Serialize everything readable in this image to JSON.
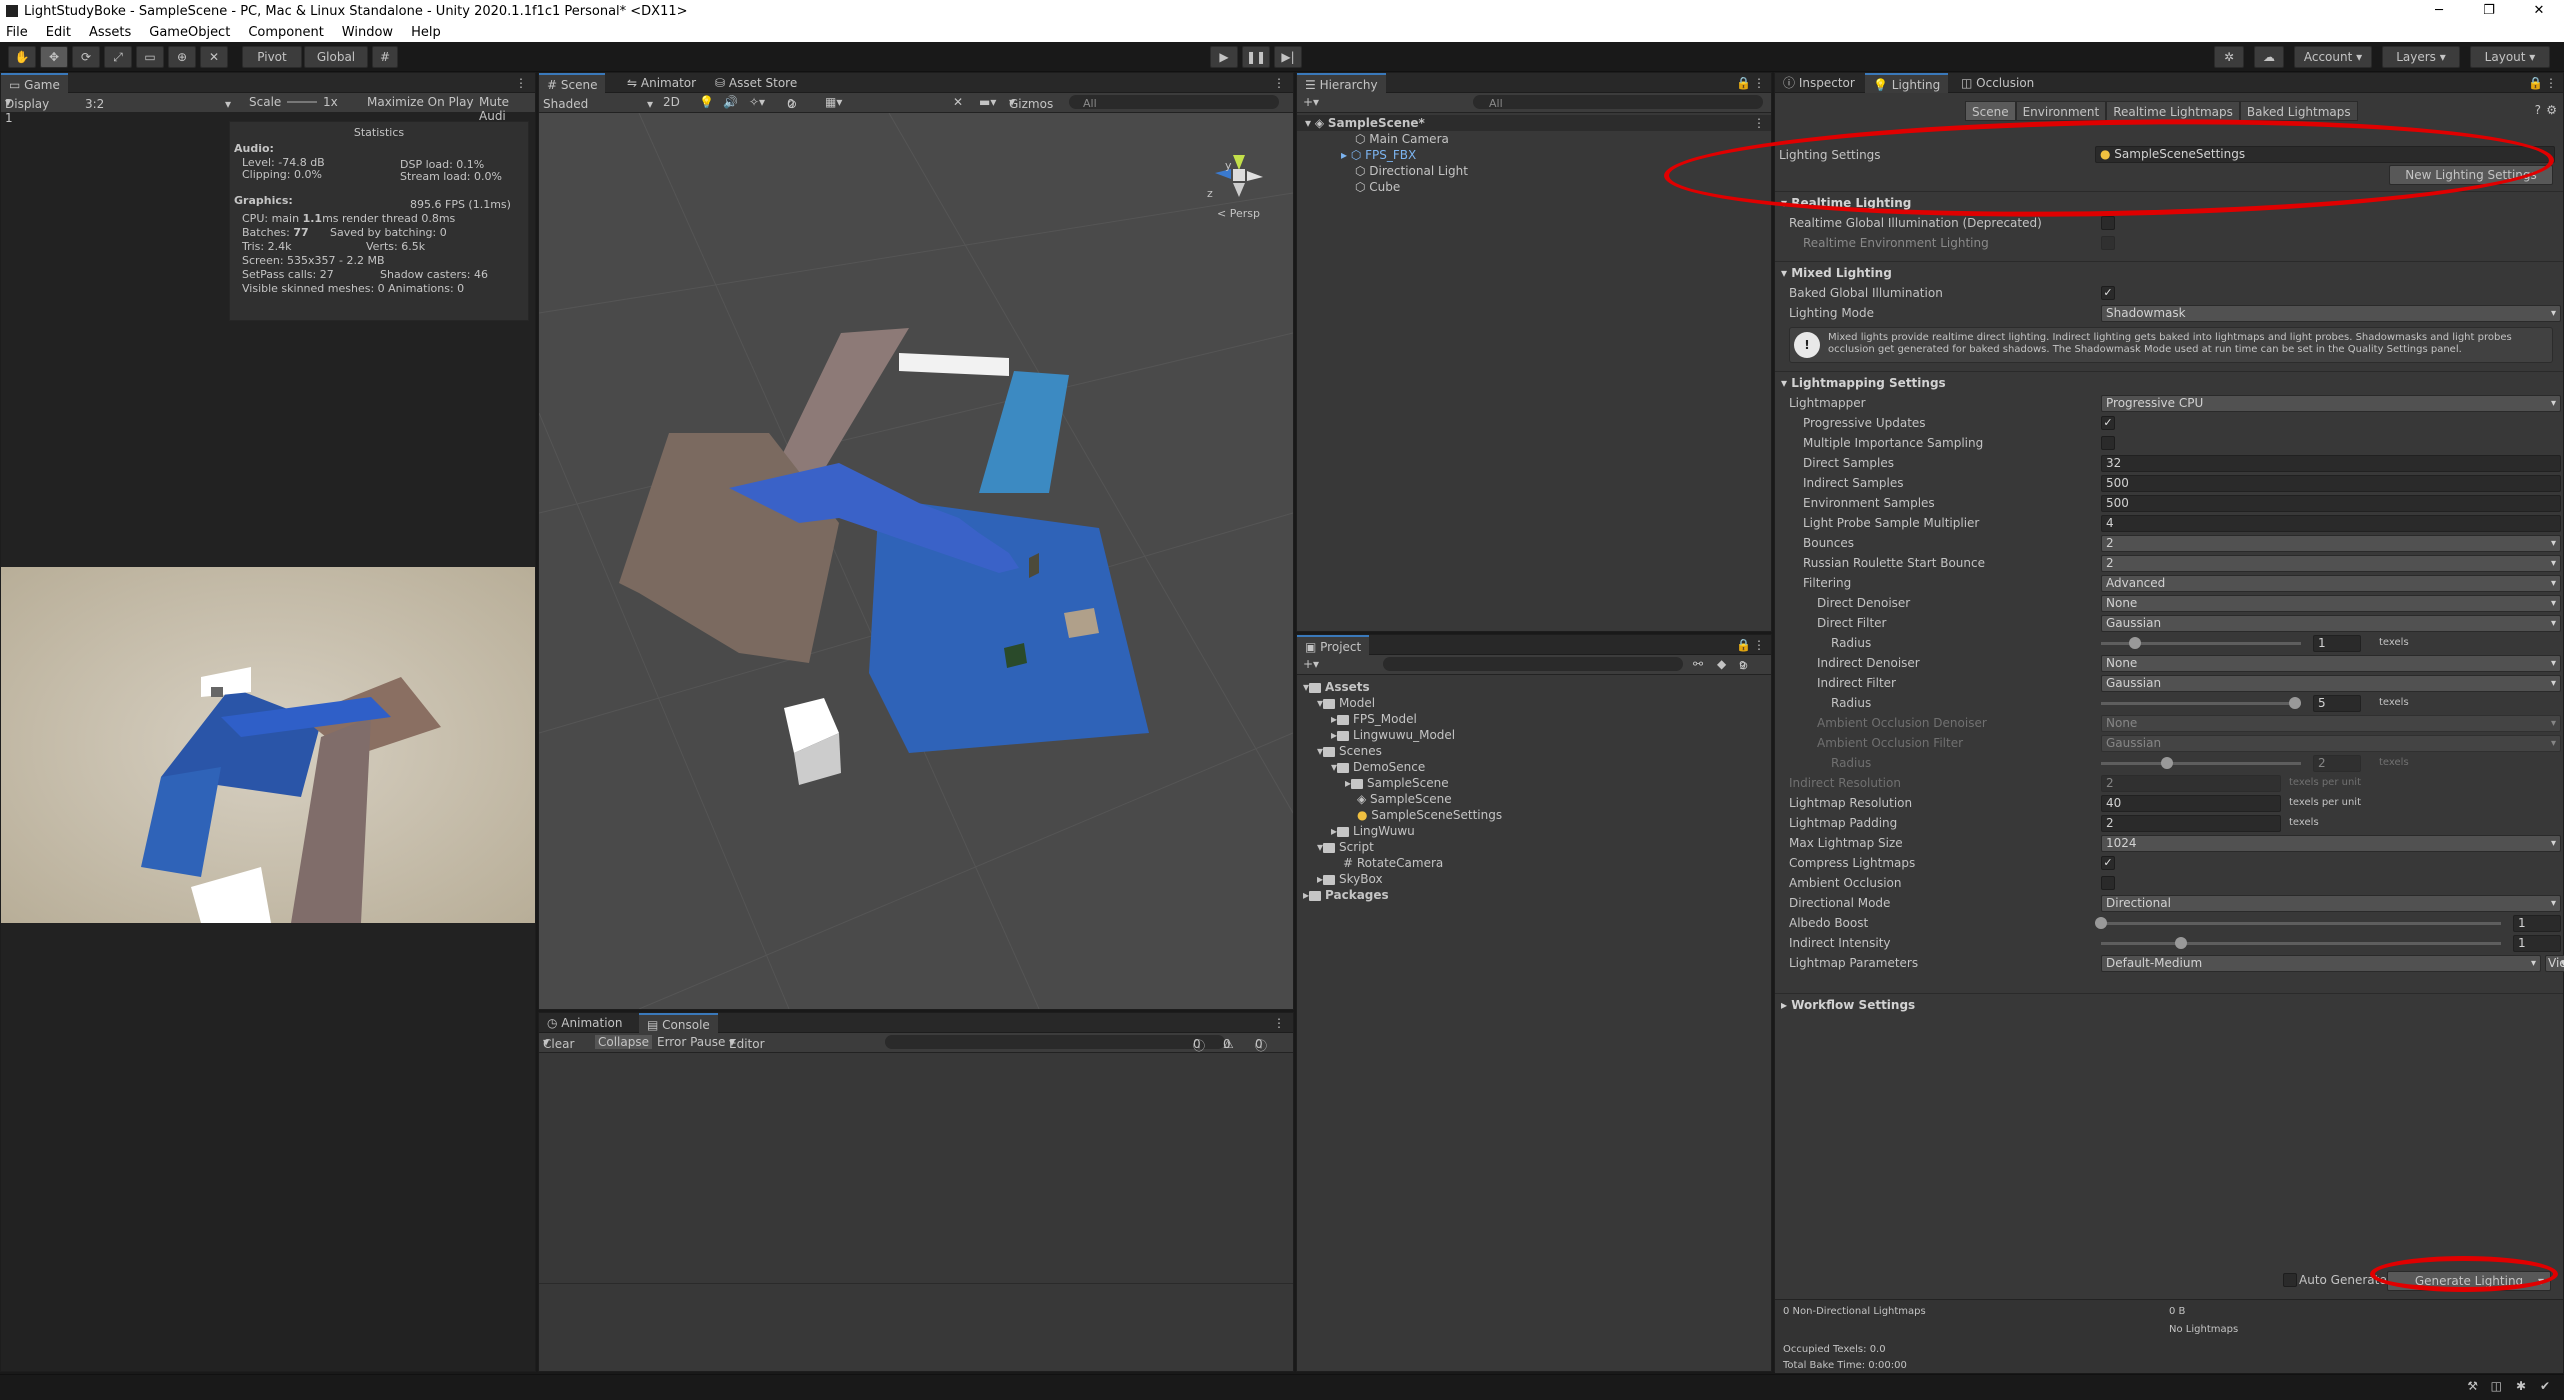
{
  "window": {
    "title": "LightStudyBoke - SampleScene - PC, Mac & Linux Standalone - Unity 2020.1.1f1c1 Personal* <DX11>",
    "minimize": "─",
    "maximize": "❐",
    "close": "✕"
  },
  "menu": [
    "File",
    "Edit",
    "Assets",
    "GameObject",
    "Component",
    "Window",
    "Help"
  ],
  "toolbar": {
    "pivot": "Pivot",
    "global": "Global",
    "account": "Account",
    "layers": "Layers",
    "layout": "Layout"
  },
  "game": {
    "tab": "Game",
    "display": "Display 1",
    "aspect": "3:2",
    "scale_label": "Scale",
    "scale_value": "1x",
    "maximize": "Maximize On Play",
    "mute": "Mute Audi",
    "stats": {
      "title": "Statistics",
      "audio_h": "Audio:",
      "level": "Level: -74.8 dB",
      "clipping": "Clipping: 0.0%",
      "dsp": "DSP load: 0.1%",
      "stream": "Stream load: 0.0%",
      "graphics_h": "Graphics:",
      "fps": "895.6 FPS (1.1ms)",
      "cpu_a": "CPU: main ",
      "cpu_b": "1.1",
      "cpu_c": "ms  render thread 0.8ms",
      "batches_a": "Batches: ",
      "batches_b": "77",
      "saved": "Saved by batching: 0",
      "tris": "Tris: 2.4k",
      "verts": "Verts: 6.5k",
      "screen": "Screen: 535x357 - 2.2 MB",
      "setpass": "SetPass calls: 27",
      "shadow": "Shadow casters: 46",
      "skinned": "Visible skinned meshes: 0  Animations: 0"
    }
  },
  "scene": {
    "tabs": [
      "Scene",
      "Animator",
      "Asset Store"
    ],
    "shading": "Shaded",
    "mode2d": "2D",
    "gizmos": "Gizmos",
    "search": "All",
    "persp": "< Persp",
    "axis_y": "y",
    "axis_z": "z",
    "hidden_count": "0"
  },
  "console": {
    "tabs": [
      "Animation",
      "Console"
    ],
    "clear": "Clear",
    "collapse": "Collapse",
    "error_pause": "Error Pause",
    "editor": "Editor",
    "counts": [
      "0",
      "0",
      "0"
    ]
  },
  "hierarchy": {
    "tab": "Hierarchy",
    "search": "All",
    "root": "SampleScene*",
    "items": [
      "Main Camera",
      "FPS_FBX",
      "Directional Light",
      "Cube"
    ]
  },
  "project": {
    "tab": "Project",
    "badge": "9",
    "items": [
      "Assets",
      "Model",
      "FPS_Model",
      "Lingwuwu_Model",
      "Scenes",
      "DemoSence",
      "SampleScene",
      "SampleScene",
      "SampleSceneSettings",
      "LingWuwu",
      "Script",
      "RotateCamera",
      "SkyBox",
      "Packages"
    ]
  },
  "inspector": {
    "tabs": [
      "Inspector",
      "Lighting",
      "Occlusion"
    ],
    "subtabs": [
      "Scene",
      "Environment",
      "Realtime Lightmaps",
      "Baked Lightmaps"
    ],
    "lighting_settings_label": "Lighting Settings",
    "lighting_settings_value": "SampleSceneSettings",
    "new_button": "New Lighting Settings",
    "realtime": {
      "header": "Realtime Lighting",
      "gi": "Realtime Global Illumination (Deprecated)",
      "env": "Realtime Environment Lighting"
    },
    "mixed": {
      "header": "Mixed Lighting",
      "baked_gi": "Baked Global Illumination",
      "mode_label": "Lighting Mode",
      "mode_value": "Shadowmask",
      "info": "Mixed lights provide realtime direct lighting. Indirect lighting gets baked into lightmaps and light probes. Shadowmasks and light probes occlusion get generated for baked shadows. The Shadowmask Mode used at run time can be set in the Quality Settings panel."
    },
    "lightmapping": {
      "header": "Lightmapping Settings",
      "rows": [
        {
          "label": "Lightmapper",
          "value": "Progressive CPU",
          "kind": "drop",
          "indent": 0
        },
        {
          "label": "Progressive Updates",
          "value": "✓",
          "kind": "check",
          "indent": 1
        },
        {
          "label": "Multiple Importance Sampling",
          "value": "",
          "kind": "check",
          "indent": 1
        },
        {
          "label": "Direct Samples",
          "value": "32",
          "kind": "field",
          "indent": 1
        },
        {
          "label": "Indirect Samples",
          "value": "500",
          "kind": "field",
          "indent": 1
        },
        {
          "label": "Environment Samples",
          "value": "500",
          "kind": "field",
          "indent": 1
        },
        {
          "label": "Light Probe Sample Multiplier",
          "value": "4",
          "kind": "field",
          "indent": 1
        },
        {
          "label": "Bounces",
          "value": "2",
          "kind": "drop",
          "indent": 1
        },
        {
          "label": "Russian Roulette Start Bounce",
          "value": "2",
          "kind": "drop",
          "indent": 1
        },
        {
          "label": "Filtering",
          "value": "Advanced",
          "kind": "drop",
          "indent": 1
        },
        {
          "label": "Direct Denoiser",
          "value": "None",
          "kind": "drop",
          "indent": 2
        },
        {
          "label": "Direct Filter",
          "value": "Gaussian",
          "kind": "drop",
          "indent": 2
        },
        {
          "label": "Radius",
          "value": "1",
          "kind": "slider",
          "indent": 3,
          "unit": "texels",
          "pos": 0.17
        },
        {
          "label": "Indirect Denoiser",
          "value": "None",
          "kind": "drop",
          "indent": 2
        },
        {
          "label": "Indirect Filter",
          "value": "Gaussian",
          "kind": "drop",
          "indent": 2
        },
        {
          "label": "Radius",
          "value": "5",
          "kind": "slider",
          "indent": 3,
          "unit": "texels",
          "pos": 0.97
        },
        {
          "label": "Ambient Occlusion Denoiser",
          "value": "None",
          "kind": "drop",
          "indent": 2,
          "disabled": true
        },
        {
          "label": "Ambient Occlusion Filter",
          "value": "Gaussian",
          "kind": "drop",
          "indent": 2,
          "disabled": true
        },
        {
          "label": "Radius",
          "value": "2",
          "kind": "slider",
          "indent": 3,
          "unit": "texels",
          "pos": 0.33,
          "disabled": true
        },
        {
          "label": "Indirect Resolution",
          "value": "2",
          "kind": "field2",
          "indent": 0,
          "unit": "texels per unit",
          "disabled": true
        },
        {
          "label": "Lightmap Resolution",
          "value": "40",
          "kind": "field2",
          "indent": 0,
          "unit": "texels per unit"
        },
        {
          "label": "Lightmap Padding",
          "value": "2",
          "kind": "field2",
          "indent": 0,
          "unit": "texels"
        },
        {
          "label": "Max Lightmap Size",
          "value": "1024",
          "kind": "drop",
          "indent": 0
        },
        {
          "label": "Compress Lightmaps",
          "value": "✓",
          "kind": "check",
          "indent": 0
        },
        {
          "label": "Ambient Occlusion",
          "value": "",
          "kind": "check",
          "indent": 0
        },
        {
          "label": "Directional Mode",
          "value": "Directional",
          "kind": "drop",
          "indent": 0
        },
        {
          "label": "Albedo Boost",
          "value": "1",
          "kind": "slider2",
          "indent": 0,
          "pos": 0.0
        },
        {
          "label": "Indirect Intensity",
          "value": "1",
          "kind": "slider2",
          "indent": 0,
          "pos": 0.2
        },
        {
          "label": "Lightmap Parameters",
          "value": "Default-Medium",
          "kind": "drop",
          "indent": 0,
          "extra": "View"
        }
      ]
    },
    "workflow": "Workflow Settings",
    "auto_generate": "Auto Generate",
    "generate": "Generate Lighting",
    "bake": {
      "lightmaps": "0 Non-Directional Lightmaps",
      "size": "0 B",
      "none": "No Lightmaps",
      "occupied": "Occupied Texels: 0.0",
      "time": "Total Bake Time: 0:00:00"
    }
  },
  "colors": {
    "accent": "#3a79bb",
    "annotation_red": "#e00000"
  }
}
